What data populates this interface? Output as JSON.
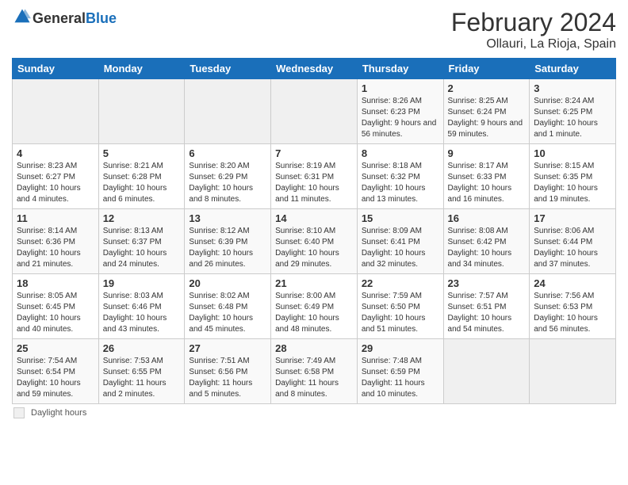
{
  "header": {
    "logo_general": "General",
    "logo_blue": "Blue",
    "month_year": "February 2024",
    "location": "Ollauri, La Rioja, Spain"
  },
  "days_of_week": [
    "Sunday",
    "Monday",
    "Tuesday",
    "Wednesday",
    "Thursday",
    "Friday",
    "Saturday"
  ],
  "weeks": [
    [
      {
        "num": "",
        "info": ""
      },
      {
        "num": "",
        "info": ""
      },
      {
        "num": "",
        "info": ""
      },
      {
        "num": "",
        "info": ""
      },
      {
        "num": "1",
        "info": "Sunrise: 8:26 AM\nSunset: 6:23 PM\nDaylight: 9 hours and 56 minutes."
      },
      {
        "num": "2",
        "info": "Sunrise: 8:25 AM\nSunset: 6:24 PM\nDaylight: 9 hours and 59 minutes."
      },
      {
        "num": "3",
        "info": "Sunrise: 8:24 AM\nSunset: 6:25 PM\nDaylight: 10 hours and 1 minute."
      }
    ],
    [
      {
        "num": "4",
        "info": "Sunrise: 8:23 AM\nSunset: 6:27 PM\nDaylight: 10 hours and 4 minutes."
      },
      {
        "num": "5",
        "info": "Sunrise: 8:21 AM\nSunset: 6:28 PM\nDaylight: 10 hours and 6 minutes."
      },
      {
        "num": "6",
        "info": "Sunrise: 8:20 AM\nSunset: 6:29 PM\nDaylight: 10 hours and 8 minutes."
      },
      {
        "num": "7",
        "info": "Sunrise: 8:19 AM\nSunset: 6:31 PM\nDaylight: 10 hours and 11 minutes."
      },
      {
        "num": "8",
        "info": "Sunrise: 8:18 AM\nSunset: 6:32 PM\nDaylight: 10 hours and 13 minutes."
      },
      {
        "num": "9",
        "info": "Sunrise: 8:17 AM\nSunset: 6:33 PM\nDaylight: 10 hours and 16 minutes."
      },
      {
        "num": "10",
        "info": "Sunrise: 8:15 AM\nSunset: 6:35 PM\nDaylight: 10 hours and 19 minutes."
      }
    ],
    [
      {
        "num": "11",
        "info": "Sunrise: 8:14 AM\nSunset: 6:36 PM\nDaylight: 10 hours and 21 minutes."
      },
      {
        "num": "12",
        "info": "Sunrise: 8:13 AM\nSunset: 6:37 PM\nDaylight: 10 hours and 24 minutes."
      },
      {
        "num": "13",
        "info": "Sunrise: 8:12 AM\nSunset: 6:39 PM\nDaylight: 10 hours and 26 minutes."
      },
      {
        "num": "14",
        "info": "Sunrise: 8:10 AM\nSunset: 6:40 PM\nDaylight: 10 hours and 29 minutes."
      },
      {
        "num": "15",
        "info": "Sunrise: 8:09 AM\nSunset: 6:41 PM\nDaylight: 10 hours and 32 minutes."
      },
      {
        "num": "16",
        "info": "Sunrise: 8:08 AM\nSunset: 6:42 PM\nDaylight: 10 hours and 34 minutes."
      },
      {
        "num": "17",
        "info": "Sunrise: 8:06 AM\nSunset: 6:44 PM\nDaylight: 10 hours and 37 minutes."
      }
    ],
    [
      {
        "num": "18",
        "info": "Sunrise: 8:05 AM\nSunset: 6:45 PM\nDaylight: 10 hours and 40 minutes."
      },
      {
        "num": "19",
        "info": "Sunrise: 8:03 AM\nSunset: 6:46 PM\nDaylight: 10 hours and 43 minutes."
      },
      {
        "num": "20",
        "info": "Sunrise: 8:02 AM\nSunset: 6:48 PM\nDaylight: 10 hours and 45 minutes."
      },
      {
        "num": "21",
        "info": "Sunrise: 8:00 AM\nSunset: 6:49 PM\nDaylight: 10 hours and 48 minutes."
      },
      {
        "num": "22",
        "info": "Sunrise: 7:59 AM\nSunset: 6:50 PM\nDaylight: 10 hours and 51 minutes."
      },
      {
        "num": "23",
        "info": "Sunrise: 7:57 AM\nSunset: 6:51 PM\nDaylight: 10 hours and 54 minutes."
      },
      {
        "num": "24",
        "info": "Sunrise: 7:56 AM\nSunset: 6:53 PM\nDaylight: 10 hours and 56 minutes."
      }
    ],
    [
      {
        "num": "25",
        "info": "Sunrise: 7:54 AM\nSunset: 6:54 PM\nDaylight: 10 hours and 59 minutes."
      },
      {
        "num": "26",
        "info": "Sunrise: 7:53 AM\nSunset: 6:55 PM\nDaylight: 11 hours and 2 minutes."
      },
      {
        "num": "27",
        "info": "Sunrise: 7:51 AM\nSunset: 6:56 PM\nDaylight: 11 hours and 5 minutes."
      },
      {
        "num": "28",
        "info": "Sunrise: 7:49 AM\nSunset: 6:58 PM\nDaylight: 11 hours and 8 minutes."
      },
      {
        "num": "29",
        "info": "Sunrise: 7:48 AM\nSunset: 6:59 PM\nDaylight: 11 hours and 10 minutes."
      },
      {
        "num": "",
        "info": ""
      },
      {
        "num": "",
        "info": ""
      }
    ]
  ],
  "footer": {
    "daylight_label": "Daylight hours"
  }
}
